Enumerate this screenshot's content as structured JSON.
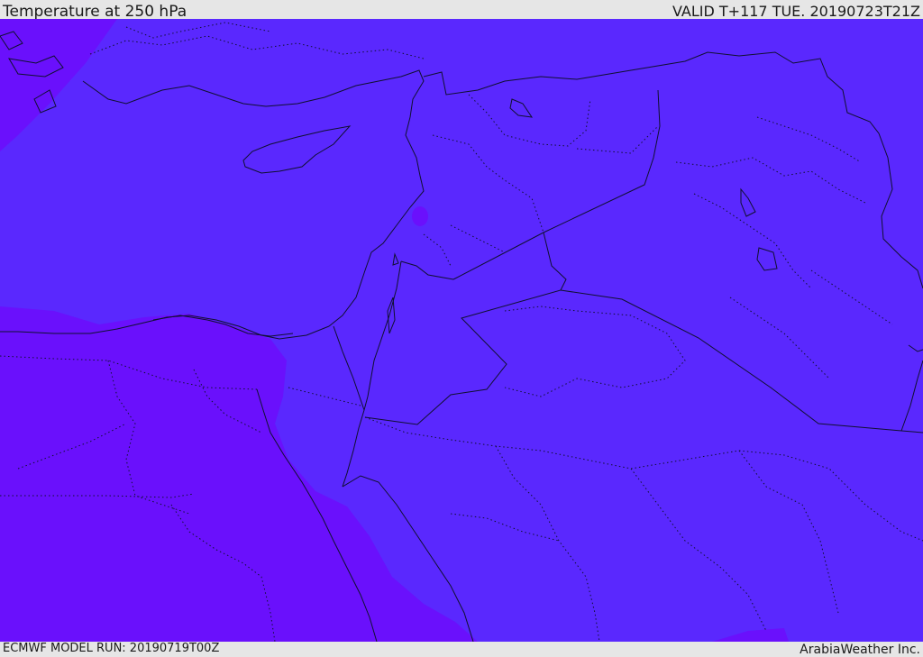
{
  "header": {
    "title": "Temperature at 250 hPa",
    "valid": "VALID T+117 TUE. 20190723T21Z"
  },
  "footer": {
    "model_run": "ECMWF MODEL RUN: 20190719T00Z",
    "credit": "ArabiaWeather Inc."
  },
  "map": {
    "colors": {
      "main_field": "#5a28fe",
      "warm_band": "#6a10fc",
      "boundary": "#101030"
    }
  }
}
